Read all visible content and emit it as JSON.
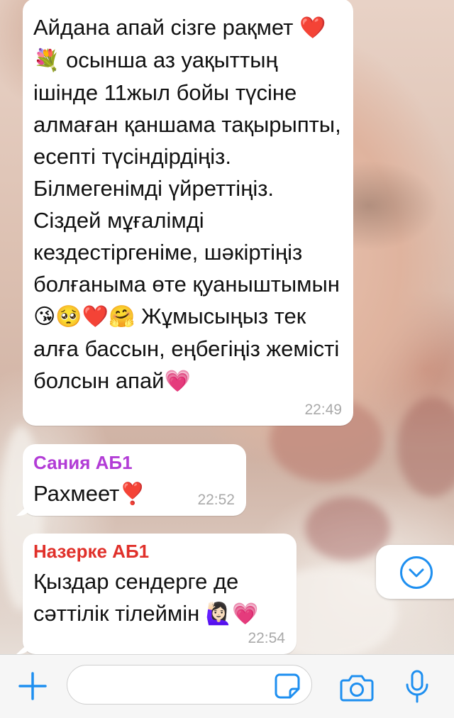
{
  "messages": [
    {
      "text_parts": [
        "Айдана апай сізге рақмет ",
        "❤️💐",
        " осынша аз уақыттың ішінде 11жыл бойы түсіне алмаған қаншама тақырыпты, есепті түсіндірдіңіз. Білмегенімді үйреттіңіз. Сіздей мұғалімді кездестіргеніме, шәкіртіңіз болғаныма өте қуаныштымын",
        "😘🥺❤️🤗",
        " Жұмысыңыз тек алға бассын, еңбегіңіз жемісті болсын апай",
        "💗"
      ],
      "time": "22:49"
    },
    {
      "sender": "Сания АБ1",
      "text": "Рахмеет",
      "emoji": "❣️",
      "time": "22:52"
    },
    {
      "sender": "Назерке АБ1",
      "text": "Қыздар сендерге де сәттілік тілеймін",
      "emoji": "🙋🏻‍♀️💗",
      "time": "22:54"
    }
  ],
  "composer": {
    "input_value": "",
    "icons": [
      "plus-icon",
      "sticker-icon",
      "camera-icon",
      "microphone-icon"
    ]
  },
  "scroll_button": {
    "icon": "chevron-down-icon"
  },
  "colors": {
    "accent": "#1e8ff0",
    "sender_sania": "#b23cd6",
    "sender_nazerke": "#e0302a",
    "time": "#a9a9a9"
  }
}
